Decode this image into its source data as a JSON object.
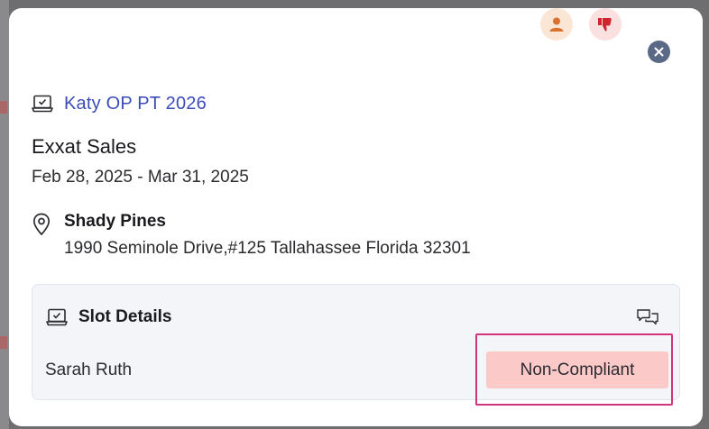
{
  "modal": {
    "actions": {
      "user_icon": "user-icon",
      "thumb_icon": "thumbs-down-icon",
      "close_icon": "close-icon"
    },
    "program_title": "Katy OP PT 2026",
    "organization": "Exxat Sales",
    "date_range": "Feb 28, 2025 - Mar 31, 2025",
    "location": {
      "name": "Shady Pines",
      "address": "1990 Seminole Drive,#125 Tallahassee Florida 32301"
    },
    "slot_details": {
      "title": "Slot Details",
      "student_name": "Sarah Ruth",
      "status": "Non-Compliant"
    }
  },
  "colors": {
    "accent_link": "#3b4cb8",
    "status_noncompliant_bg": "#fcc9c9",
    "highlight_border": "#d0347a"
  }
}
